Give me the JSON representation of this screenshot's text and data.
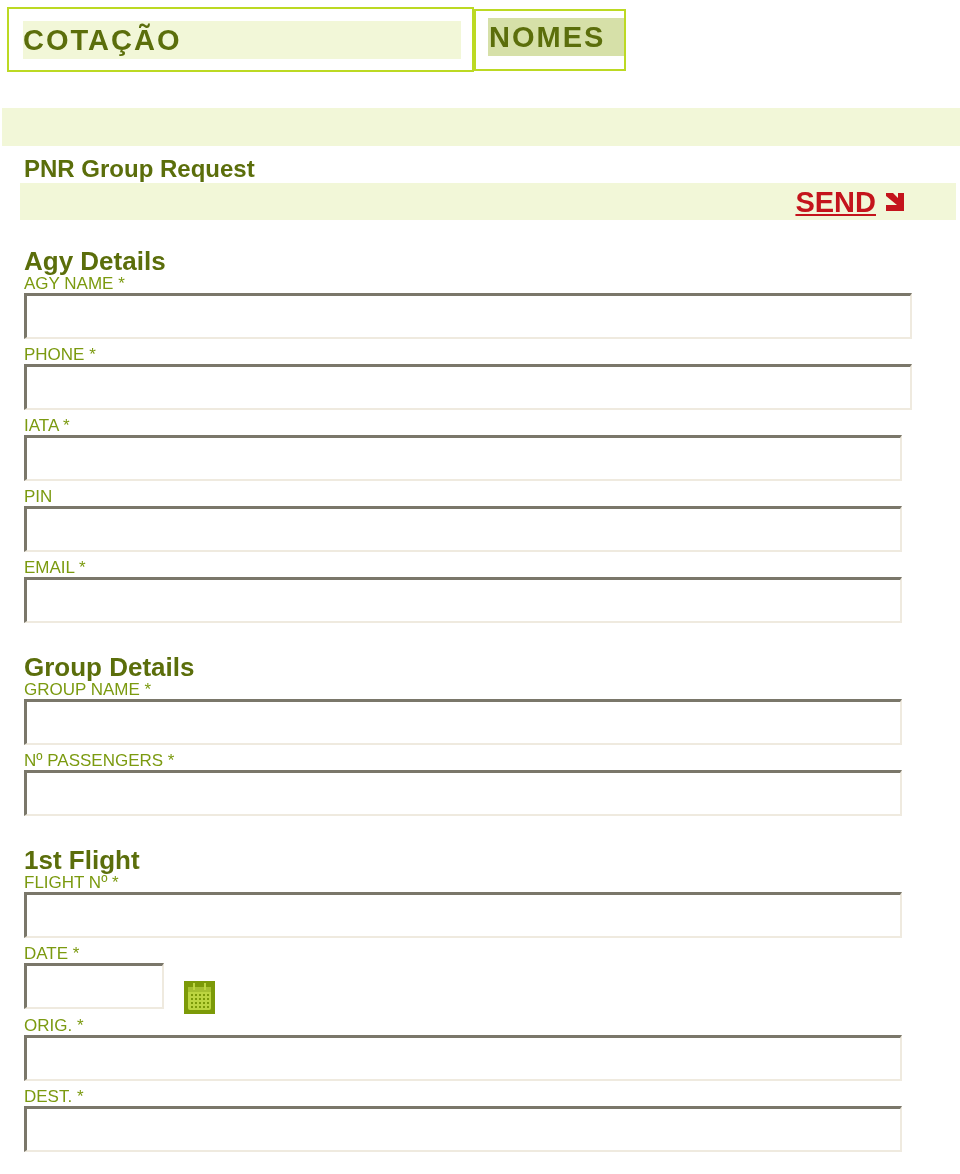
{
  "tabs": [
    {
      "label": "COTAÇÃO",
      "selected": false
    },
    {
      "label": "NOMES",
      "selected": true
    }
  ],
  "form_title": "PNR Group Request",
  "send_link": "SEND",
  "sections": [
    {
      "title": "Agy Details",
      "fields": [
        {
          "label": "AGY NAME *",
          "kind": "text"
        },
        {
          "label": "PHONE *",
          "kind": "text"
        },
        {
          "label": "IATA *",
          "kind": "text"
        },
        {
          "label": "PIN",
          "kind": "text"
        },
        {
          "label": "EMAIL *",
          "kind": "text"
        }
      ]
    },
    {
      "title": "Group Details",
      "fields": [
        {
          "label": "GROUP NAME *",
          "kind": "text"
        },
        {
          "label": "Nº PASSENGERS *",
          "kind": "text"
        }
      ]
    },
    {
      "title": "1st Flight",
      "fields": [
        {
          "label": "FLIGHT Nº *",
          "kind": "text"
        },
        {
          "label": "DATE *",
          "kind": "date"
        },
        {
          "label": "ORIG. *",
          "kind": "text"
        },
        {
          "label": "DEST. *",
          "kind": "text"
        }
      ]
    }
  ]
}
